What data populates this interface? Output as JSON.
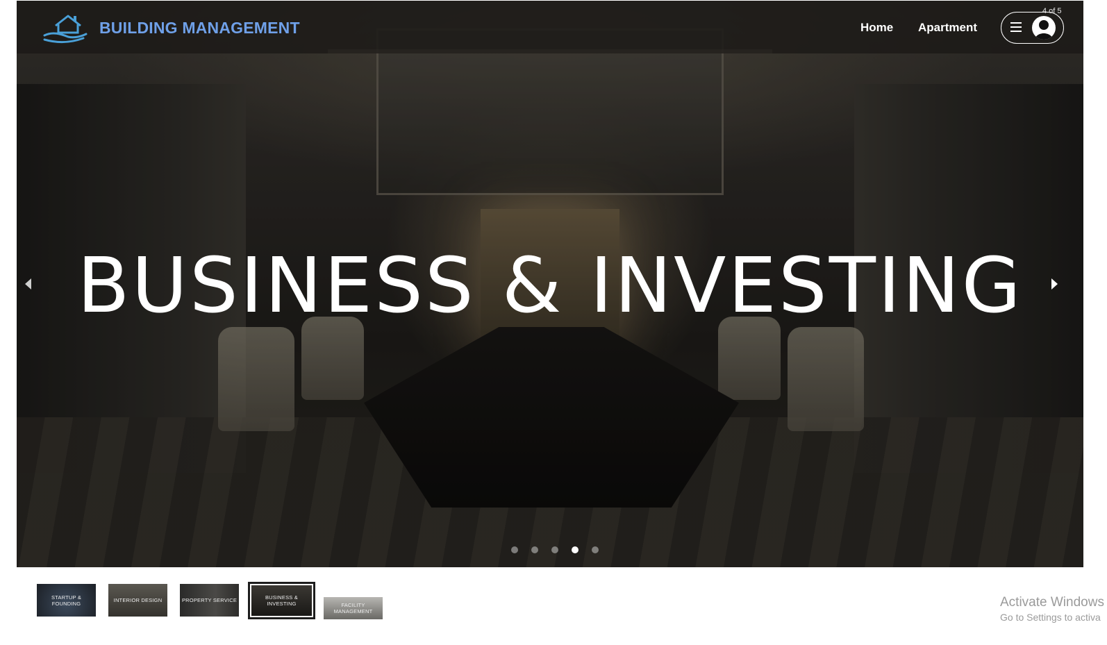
{
  "header": {
    "brand": "BUILDING MANAGEMENT",
    "logo_icon": "house-hand-icon",
    "nav": [
      {
        "label": "Home"
      },
      {
        "label": "Apartment"
      }
    ],
    "menu_icon": "hamburger-icon",
    "avatar_icon": "user-avatar-icon"
  },
  "slider": {
    "counter": "4 of 5",
    "title": "BUSINESS & INVESTING",
    "current_index": 4,
    "total": 5,
    "prev_icon": "chevron-left-icon",
    "next_icon": "chevron-right-icon"
  },
  "thumbnails": [
    {
      "label": "STARTUP & FOUNDING",
      "color": "#2a3240"
    },
    {
      "label": "INTERIOR DESIGN",
      "color": "#4c4a44"
    },
    {
      "label": "PROPERTY SERVICE",
      "color": "#3b3a38"
    },
    {
      "label": "BUSINESS & INVESTING",
      "color": "#2c2a26"
    },
    {
      "label": "FACILITY MANAGEMENT",
      "color": "#8d8c88"
    }
  ],
  "watermark": {
    "title": "Activate Windows",
    "subtitle": "Go to Settings to activa"
  },
  "colors": {
    "brand": "#6fa0e8",
    "accent_line": "#1d1d1d"
  }
}
